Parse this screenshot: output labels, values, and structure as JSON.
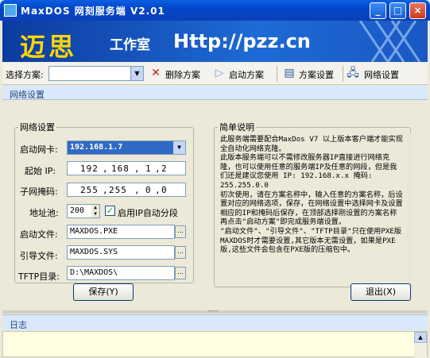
{
  "window": {
    "title": "MaxDOS 网刻服务端 V2.01",
    "controls": {
      "minimize": "_",
      "maximize": "□",
      "close": "×"
    }
  },
  "banner": {
    "logo_text": "迈思",
    "studio_text": "工作室",
    "url_text": "Http://pzz.cn"
  },
  "toolbar": {
    "plan_label": "选择方案:",
    "plan_value": "",
    "delete_label": "删除方案",
    "start_label": "启动方案",
    "plan_settings_label": "方案设置",
    "network_settings_label": "网络设置"
  },
  "panel": {
    "title": "网络设置"
  },
  "network": {
    "legend": "网络设置",
    "nic_label": "启动网卡:",
    "nic_value": "192.168.1.7",
    "start_ip_label": "起始 IP:",
    "start_ip": [
      "192",
      "168",
      "1",
      "2"
    ],
    "subnet_label": "子网掩码:",
    "subnet": [
      "255",
      "255",
      "0",
      "0"
    ],
    "pool_label": "地址池:",
    "pool_value": "200",
    "auto_segment_label": "启用IP自动分段",
    "auto_segment_checked": true,
    "boot_file_label": "启动文件:",
    "boot_file_value": "MAXDOS.PXE",
    "guide_file_label": "引导文件:",
    "guide_file_value": "MAXDOS.SYS",
    "tftp_label": "TFTP目录:",
    "tftp_value": "D:\\MAXDOS\\",
    "browse_label": "..."
  },
  "description": {
    "legend": "简单说明",
    "text": "此服务端需要配合MaxDos V7 以上版本客户端才能实现全自动化网络克隆。\n此版本服务端可以不需修改服务器IP直接进行网络克隆，也可以使用任意的服务端IP及任意的网段，但是我们还是建议您使用 IP: 192.168.x.x 掩码: 255.255.0.0\n初次使用，请在方案名称中，输入任意的方案名称，后设置对应的网络选项，保存，在网络设置中选择网卡及设置相应的IP和掩码后保存，在顶部选择刚设置的方案名称再点击\"启动方案\"即完成服务端设置。\n\"启动文件\"、\"引导文件\"、\"TFTP目录\"只在使用PXE版MAXDOS时才需要设置,其它版本无需设置，如果是PXE版,这些文件会包含在PXE版的压缩包中。"
  },
  "buttons": {
    "save": "保存(Y)",
    "exit": "退出(X)"
  },
  "log": {
    "title": "日志"
  }
}
